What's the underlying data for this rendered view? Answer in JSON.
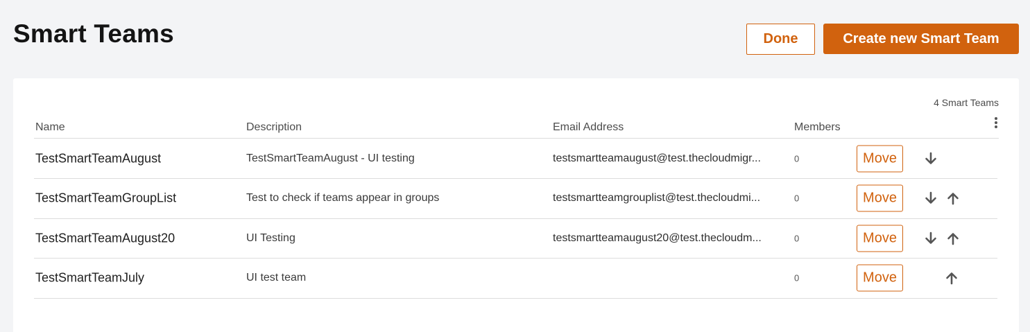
{
  "page": {
    "title": "Smart Teams"
  },
  "actions": {
    "done_label": "Done",
    "create_label": "Create new Smart Team"
  },
  "table": {
    "count_label": "4 Smart Teams",
    "columns": {
      "name": "Name",
      "description": "Description",
      "email": "Email Address",
      "members": "Members"
    },
    "move_label": "Move",
    "rows": [
      {
        "name": "TestSmartTeamAugust",
        "description": "TestSmartTeamAugust - UI testing",
        "email": "testsmartteamaugust@test.thecloudmigr...",
        "members": "0",
        "move_down": true,
        "move_up": false
      },
      {
        "name": "TestSmartTeamGroupList",
        "description": "Test to check if teams appear in groups",
        "email": "testsmartteamgrouplist@test.thecloudmi...",
        "members": "0",
        "move_down": true,
        "move_up": true
      },
      {
        "name": "TestSmartTeamAugust20",
        "description": "UI Testing",
        "email": "testsmartteamaugust20@test.thecloudm...",
        "members": "0",
        "move_down": true,
        "move_up": true
      },
      {
        "name": "TestSmartTeamJuly",
        "description": "UI test team",
        "email": "",
        "members": "0",
        "move_down": false,
        "move_up": true
      }
    ]
  },
  "icons": {
    "arrow_down": "arrow-down-icon",
    "arrow_up": "arrow-up-icon",
    "more": "more-vertical-icon"
  },
  "colors": {
    "accent": "#d1620e",
    "background": "#f3f4f6",
    "card": "#ffffff",
    "arrow": "#555555"
  }
}
